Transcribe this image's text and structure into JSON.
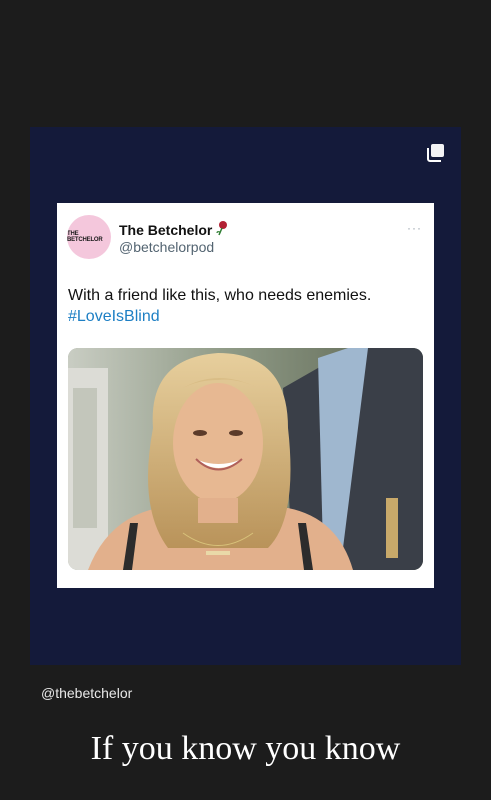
{
  "story": {
    "caption_handle": "@thebetchelor",
    "overlay_text": "If you know you know"
  },
  "tweet": {
    "avatar_text": "THE BETCHELOR",
    "display_name": "The Betchelor",
    "handle": "@betchelorpod",
    "more": "···",
    "text": "With a friend like this, who needs enemies.",
    "hashtag": "#LoveIsBlind"
  },
  "icons": {
    "multi_post": "multiple-posts-icon",
    "rose": "rose-icon"
  },
  "colors": {
    "background": "#1c1c1c",
    "card": "#141a3a",
    "hashtag": "#1d7fc4",
    "avatar": "#f4c7dc"
  }
}
